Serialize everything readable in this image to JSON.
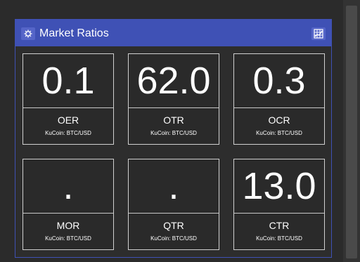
{
  "panel": {
    "title": "Market Ratios",
    "settings_icon": "gear-icon",
    "chart_icon": "grid-chart-icon"
  },
  "metrics": [
    {
      "name": "OER",
      "value": "0.1",
      "source": "KuCoin: BTC/USD"
    },
    {
      "name": "OTR",
      "value": "62.0",
      "source": "KuCoin: BTC/USD"
    },
    {
      "name": "OCR",
      "value": "0.3",
      "source": "KuCoin: BTC/USD"
    },
    {
      "name": "MOR",
      "value": ".",
      "source": "KuCoin: BTC/USD"
    },
    {
      "name": "QTR",
      "value": ".",
      "source": "KuCoin: BTC/USD"
    },
    {
      "name": "CTR",
      "value": "13.0",
      "source": "KuCoin: BTC/USD"
    }
  ],
  "colors": {
    "accent": "#3f51b5",
    "background": "#2b2b2b",
    "card_border": "#d0d0d0",
    "text": "#ffffff"
  }
}
